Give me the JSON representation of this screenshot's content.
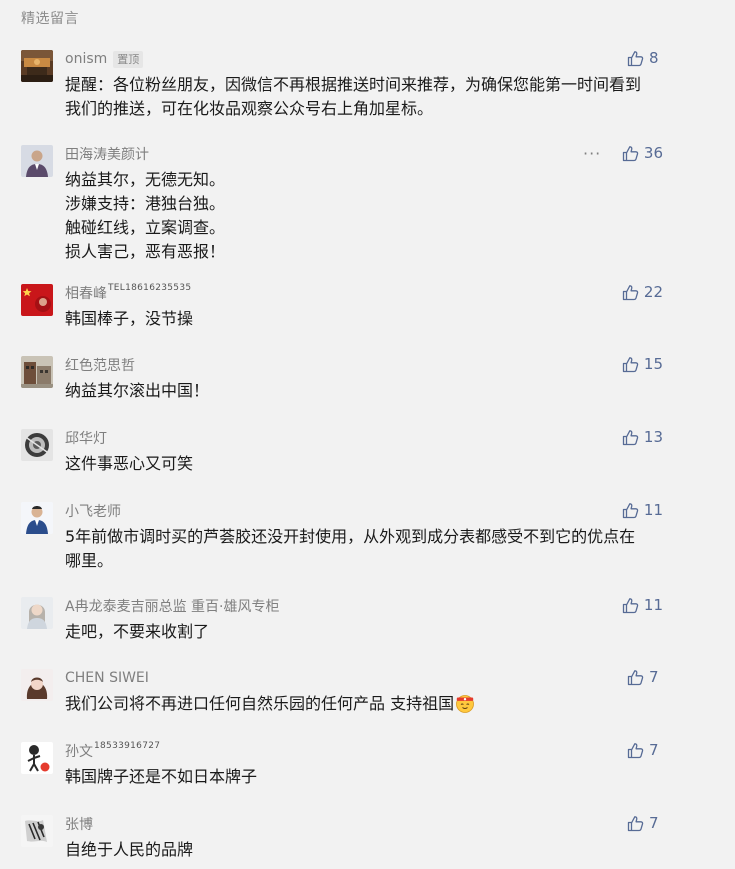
{
  "section_title": "精选留言",
  "colors": {
    "like": "#576b95",
    "name": "#7f7f7f",
    "background": "#f2f2f2"
  },
  "comments": [
    {
      "name": "onism",
      "badge": "置顶",
      "likes": "8",
      "avatar": "avatar-landscape-warm",
      "lines": [
        "提醒：各位粉丝朋友，因微信不再根据推送时间来推荐，为确保您能第一时间看到",
        "我们的推送，可在化妆品观察公众号右上角加星标。"
      ]
    },
    {
      "name": "田海涛美颜计",
      "more": "···",
      "likes": "36",
      "avatar": "avatar-person-suit",
      "lines": [
        "纳益其尔，无德无知。",
        "涉嫌支持：港独台独。",
        "触碰红线，立案调查。",
        "损人害己，恶有恶报！"
      ]
    },
    {
      "name": "相春峰",
      "name_suffix": "TEL18616235535",
      "likes": "22",
      "avatar": "avatar-flag-red",
      "lines": [
        "韩国棒子，没节操"
      ]
    },
    {
      "name": "红色范思哲",
      "likes": "15",
      "avatar": "avatar-building",
      "lines": [
        "纳益其尔滚出中国！"
      ]
    },
    {
      "name": "邱华灯",
      "likes": "13",
      "avatar": "avatar-round-object",
      "lines": [
        "这件事恶心又可笑"
      ]
    },
    {
      "name": "小飞老师",
      "likes": "11",
      "avatar": "avatar-person-blue",
      "lines": [
        "5年前做市调时买的芦荟胶还没开封使用，从外观到成分表都感受不到它的优点在",
        "哪里。"
      ]
    },
    {
      "name": "A冉龙泰麦吉丽总监 重百·雄风专柜",
      "likes": "11",
      "avatar": "avatar-woman-light",
      "lines": [
        "走吧，不要来收割了"
      ]
    },
    {
      "name": "CHEN SIWEI",
      "likes": "7",
      "avatar": "avatar-woman-hair",
      "lines": [
        "我们公司将不再进口任何自然乐园的任何产品 支持祖国"
      ],
      "emoji": "headband-emoji"
    },
    {
      "name": "孙文",
      "name_suffix": "18533916727",
      "likes": "7",
      "avatar": "avatar-cartoon",
      "lines": [
        "韩国牌子还是不如日本牌子"
      ]
    },
    {
      "name": "张博",
      "likes": "7",
      "avatar": "avatar-sketch",
      "lines": [
        "自绝于人民的品牌"
      ]
    }
  ]
}
